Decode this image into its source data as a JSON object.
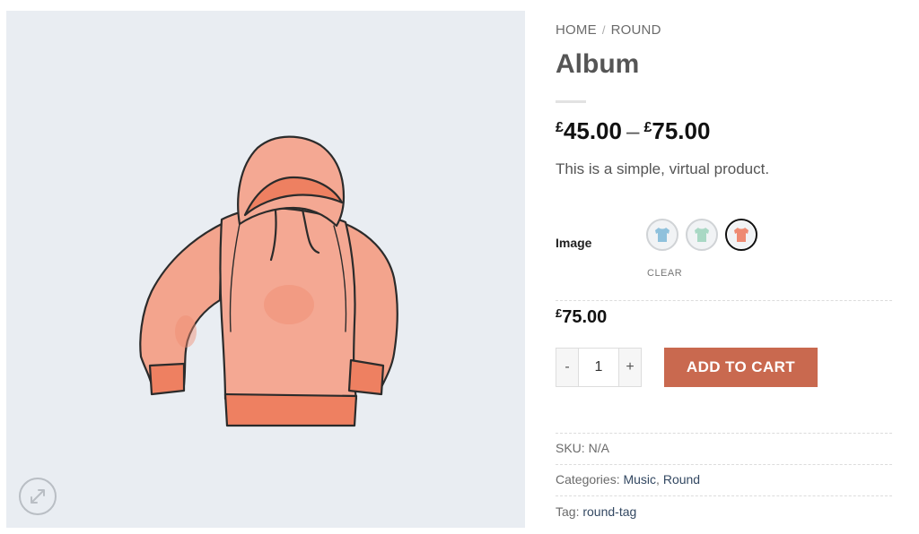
{
  "breadcrumb": {
    "items": [
      "HOME",
      "ROUND"
    ],
    "separator": "/"
  },
  "product": {
    "title": "Album",
    "price_range": {
      "currency": "£",
      "min": "45.00",
      "max": "75.00",
      "dash": "–"
    },
    "short_description": "This is a simple, virtual product.",
    "variation": {
      "label": "Image",
      "swatches": [
        {
          "name": "Blue t-shirt",
          "color": "#8fc1dc",
          "selected": false
        },
        {
          "name": "Green t-shirt",
          "color": "#a9d8c4",
          "selected": false
        },
        {
          "name": "Coral t-shirt",
          "color": "#ee8a72",
          "selected": true
        }
      ],
      "clear_label": "CLEAR"
    },
    "variation_price": {
      "currency": "£",
      "amount": "75.00"
    },
    "quantity": {
      "minus": "-",
      "value": "1",
      "plus": "+"
    },
    "add_to_cart_label": "ADD TO CART",
    "meta": {
      "sku_label": "SKU:",
      "sku_value": "N/A",
      "categories_label": "Categories:",
      "categories": [
        "Music",
        "Round"
      ],
      "tag_label": "Tag:",
      "tags": [
        "round-tag"
      ]
    }
  },
  "gallery": {
    "image_subject": "coral hoodie illustration",
    "zoom_icon": "expand-icon",
    "background": "#e9edf2"
  },
  "colors": {
    "accent": "#c9694f",
    "link": "#334862",
    "hoodie": "#f2a08a"
  }
}
